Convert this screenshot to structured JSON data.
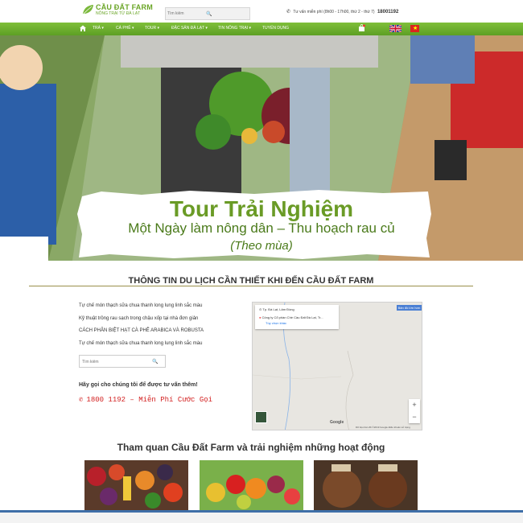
{
  "logo": {
    "title": "CẦU ĐẤT FARM",
    "subtitle": "NÔNG TRẠI TỪ ĐÀ LẠT"
  },
  "header": {
    "search_placeholder": "Tìm kiếm",
    "hotline_label": "Tư vấn miễn phí (8h00 - 17h00, thứ 2 - thứ 7)",
    "hotline_number": "18001192"
  },
  "nav": {
    "items": [
      "TRÀ",
      "CÀ PHÊ",
      "TOUR",
      "ĐẶC SẢN ĐÀ LẠT",
      "TIN NÔNG TRẠI",
      "TUYỂN DỤNG"
    ],
    "colors": {
      "bar": "#6aad2c"
    }
  },
  "hero": {
    "title": "Tour Trải Nghiệm",
    "subtitle": "Một Ngày làm nông dân – Thu hoạch rau củ",
    "season": "(Theo mùa)"
  },
  "info": {
    "heading": "THÔNG TIN DU LỊCH CẦN THIẾT KHI ĐẾN CẦU ĐẤT FARM",
    "links": [
      "Tự chế món thạch sữa chua thanh long lung linh sắc màu",
      "Kỹ thuật trồng rau sạch trong chậu xốp tại nhà đơn giản",
      "CÁCH PHÂN BIỆT HẠT CÀ PHÊ ARABICA VÀ ROBUSTA",
      "Tự chế món thạch sữa chua thanh long lung linh sắc màu"
    ],
    "search_placeholder": "Tìm kiếm",
    "call_text": "Hãy gọi cho chúng tôi để được tư vấn thêm!",
    "call_phone": "1800 1192 – Miễn Phí Cước Gọi"
  },
  "map": {
    "location": "Tp. Đà Lạt, Lâm Đồng",
    "company": "Công ty Cổ phần Chè Cầu Đất Đà Lạt, Tr...",
    "more_link": "Tùy chọn khác",
    "larger_map": "Bản đồ lớn hơn",
    "google": "Google",
    "attribution": "Dữ liệu bản đồ ©2019 Google   Điều khoản sử dụng"
  },
  "tours": {
    "heading": "Tham quan Cầu Đất Farm và trải nghiệm những hoạt động"
  }
}
